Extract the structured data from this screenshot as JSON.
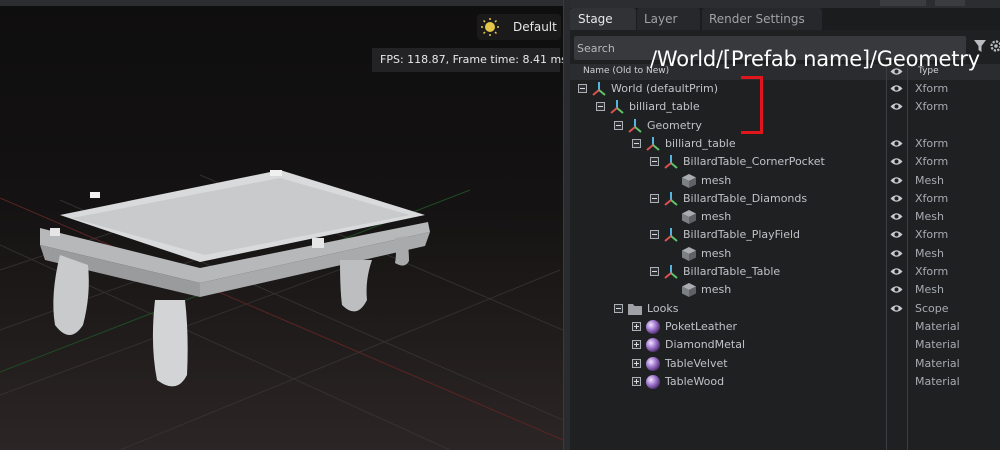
{
  "viewport": {
    "camera_label": "Default",
    "fps_text": "FPS: 118.87, Frame time: 8.41 ms"
  },
  "stage": {
    "tabs": [
      {
        "label": "Stage",
        "active": true
      },
      {
        "label": "Layer",
        "active": false
      },
      {
        "label": "Render Settings",
        "active": false
      }
    ],
    "search_placeholder": "Search",
    "columns": {
      "name": "Name (Old to New)",
      "type": "Type"
    },
    "tree": [
      {
        "label": "World (defaultPrim)",
        "type": "Xform",
        "depth": 0,
        "icon": "xform-icon",
        "expander": "minus",
        "visible": true
      },
      {
        "label": "billiard_table",
        "type": "Xform",
        "depth": 1,
        "icon": "xform-icon",
        "expander": "minus",
        "visible": true
      },
      {
        "label": "Geometry",
        "type": "",
        "depth": 2,
        "icon": "xform-icon",
        "expander": "minus",
        "visible": false
      },
      {
        "label": "billiard_table",
        "type": "Xform",
        "depth": 3,
        "icon": "xform-icon",
        "expander": "minus",
        "visible": true
      },
      {
        "label": "BillardTable_CornerPocket",
        "type": "Xform",
        "depth": 4,
        "icon": "xform-icon",
        "expander": "minus",
        "visible": true
      },
      {
        "label": "mesh",
        "type": "Mesh",
        "depth": 5,
        "icon": "mesh-icon",
        "expander": "none",
        "visible": true
      },
      {
        "label": "BillardTable_Diamonds",
        "type": "Xform",
        "depth": 4,
        "icon": "xform-icon",
        "expander": "minus",
        "visible": true
      },
      {
        "label": "mesh",
        "type": "Mesh",
        "depth": 5,
        "icon": "mesh-icon",
        "expander": "none",
        "visible": true
      },
      {
        "label": "BillardTable_PlayField",
        "type": "Xform",
        "depth": 4,
        "icon": "xform-icon",
        "expander": "minus",
        "visible": true
      },
      {
        "label": "mesh",
        "type": "Mesh",
        "depth": 5,
        "icon": "mesh-icon",
        "expander": "none",
        "visible": true
      },
      {
        "label": "BillardTable_Table",
        "type": "Xform",
        "depth": 4,
        "icon": "xform-icon",
        "expander": "minus",
        "visible": true
      },
      {
        "label": "mesh",
        "type": "Mesh",
        "depth": 5,
        "icon": "mesh-icon",
        "expander": "none",
        "visible": true
      },
      {
        "label": "Looks",
        "type": "Scope",
        "depth": 2,
        "icon": "folder-icon",
        "expander": "minus",
        "visible": true
      },
      {
        "label": "PoketLeather",
        "type": "Material",
        "depth": 3,
        "icon": "material-sphere-icon",
        "expander": "plus",
        "visible": false
      },
      {
        "label": "DiamondMetal",
        "type": "Material",
        "depth": 3,
        "icon": "material-sphere-icon",
        "expander": "plus",
        "visible": false
      },
      {
        "label": "TableVelvet",
        "type": "Material",
        "depth": 3,
        "icon": "material-sphere-icon",
        "expander": "plus",
        "visible": false
      },
      {
        "label": "TableWood",
        "type": "Material",
        "depth": 3,
        "icon": "material-sphere-icon",
        "expander": "plus",
        "visible": false
      }
    ]
  },
  "annotation": {
    "text": "/World/[Prefab name]/Geometry",
    "color": "#e0161c"
  }
}
